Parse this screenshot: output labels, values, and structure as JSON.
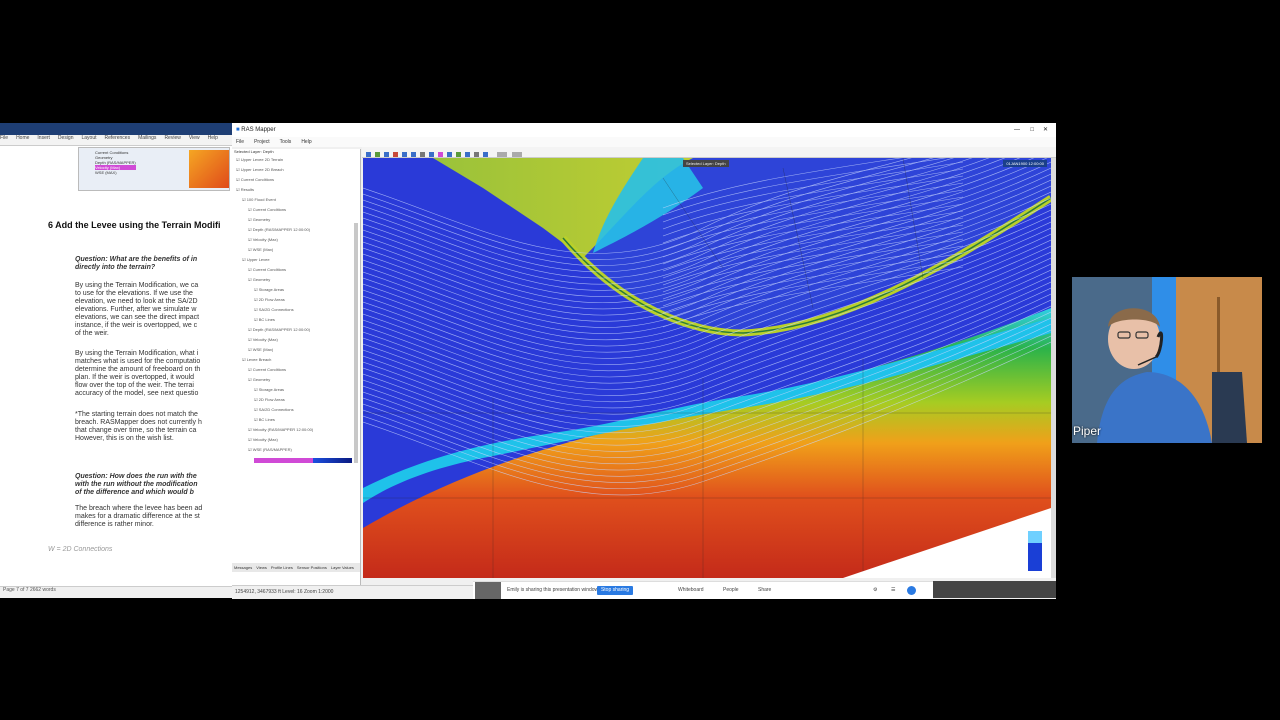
{
  "word_doc": {
    "ribbon_tabs": [
      "File",
      "Home",
      "Insert",
      "Design",
      "Layout",
      "References",
      "Mailings",
      "Review",
      "View",
      "Help"
    ],
    "thumb_items": [
      "Current Conditions",
      "Geometry",
      "Depth (RAS/MAPPER)",
      "Velocity (Max)",
      "WSE (MAX)"
    ],
    "section_heading": "6   Add the Levee using the Terrain Modifi",
    "question1": "Question:  What are the benefits of in",
    "question1b": "directly into the terrain?",
    "para1": [
      "By using the Terrain Modification, we ca",
      "to use for the elevations.  If we use the",
      "elevation, we need to look at the SA/2D",
      "elevations.  Further, after we simulate w",
      "elevations, we can see the direct impact",
      "instance, if the weir is overtopped, we c",
      "of the weir."
    ],
    "para2": [
      "By using the Terrain Modification, what i",
      "matches what is used for the computatio",
      "determine the amount of freeboard on th",
      "plan.  If the weir is overtopped, it would",
      "flow over the top of the weir.  The terrai",
      "accuracy of the model, see next questio"
    ],
    "para3": [
      "*The starting terrain does not match the",
      "breach.  RASMapper does not currently h",
      "that change over time, so the terrain ca",
      "However, this is on the wish list."
    ],
    "question2": "Question:  How does the run with the",
    "question2b": "with the run without the modification",
    "question2c": "of the difference and which would b",
    "para4": [
      "The breach where the levee has been ad",
      "makes for a dramatic difference at the st",
      "difference is rather minor."
    ],
    "footer_note": "W = 2D Connections",
    "status_left": "Page 7 of 7   2662 words",
    "accent_color": "#1e3e74"
  },
  "ras_mapper": {
    "title": "RAS Mapper",
    "menu": [
      "File",
      "Project",
      "Tools",
      "Help"
    ],
    "layer_header": "Selected Layer: Depth",
    "tree_items": [
      {
        "indent": 0,
        "text": "Upper Levee 2D Terrain"
      },
      {
        "indent": 0,
        "text": "Upper Levee 2D Breach"
      },
      {
        "indent": 0,
        "text": "Current Conditions"
      },
      {
        "indent": 0,
        "text": "Results"
      },
      {
        "indent": 1,
        "text": "100 Flood Event"
      },
      {
        "indent": 2,
        "text": "Current Conditions"
      },
      {
        "indent": 2,
        "text": "Geometry"
      },
      {
        "indent": 2,
        "text": "Depth (RAS/MAPPER 12:00:00)"
      },
      {
        "indent": 2,
        "text": "Velocity (Max)"
      },
      {
        "indent": 2,
        "text": "WSE (Max)"
      },
      {
        "indent": 1,
        "text": "Upper Levee"
      },
      {
        "indent": 2,
        "text": "Current Conditions"
      },
      {
        "indent": 2,
        "text": "Geometry"
      },
      {
        "indent": 3,
        "text": "Storage Areas"
      },
      {
        "indent": 3,
        "text": "2D Flow Areas"
      },
      {
        "indent": 3,
        "text": "SA/2D Connections"
      },
      {
        "indent": 3,
        "text": "BC Lines"
      },
      {
        "indent": 2,
        "text": "Depth (RAS/MAPPER 12:00:00)"
      },
      {
        "indent": 2,
        "text": "Velocity (Max)"
      },
      {
        "indent": 2,
        "text": "WSE (Max)"
      },
      {
        "indent": 1,
        "text": "Levee Breach"
      },
      {
        "indent": 2,
        "text": "Current Conditions"
      },
      {
        "indent": 2,
        "text": "Geometry"
      },
      {
        "indent": 3,
        "text": "Storage Areas"
      },
      {
        "indent": 3,
        "text": "2D Flow Areas"
      },
      {
        "indent": 3,
        "text": "SA/2D Connections"
      },
      {
        "indent": 3,
        "text": "BC Lines"
      },
      {
        "indent": 2,
        "text": "Velocity (RAS/MAPPER 12:00:00)"
      },
      {
        "indent": 2,
        "text": "Velocity (Max)"
      },
      {
        "indent": 2,
        "text": "WSE (RAS/MAPPER)"
      }
    ],
    "bottom_tabs": [
      "Messages",
      "Views",
      "Profile Lines",
      "Sensor Positions",
      "Layer Values"
    ],
    "map_label_top": "Selected Layer: Depth",
    "map_label_right": "01JAN1900 12:00:00",
    "status_text": "1254912, 3467933 ft   Level: 16   Zoom 1:2000",
    "legend_colors": [
      "#6fd0ff",
      "#1a3fd6"
    ]
  },
  "callbar": {
    "text": "Emily is sharing this presentation window",
    "button": "Stop sharing",
    "items": [
      "Whiteboard",
      "People",
      "Share"
    ]
  },
  "webcam": {
    "name": "Piper"
  }
}
